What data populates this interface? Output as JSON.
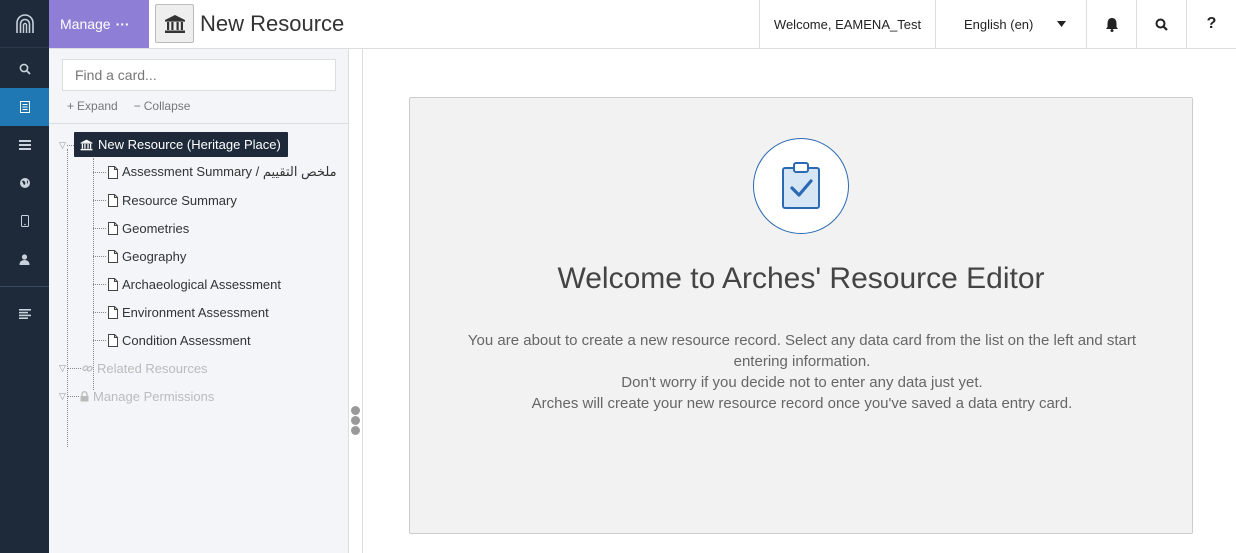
{
  "topbar": {
    "manage_label": "Manage",
    "manage_dots": "···",
    "page_title": "New Resource",
    "welcome": "Welcome, EAMENA_Test",
    "language": "English (en)"
  },
  "sidebar": {
    "search_placeholder": "Find a card...",
    "expand_label": "Expand",
    "collapse_label": "Collapse",
    "root_label": "New Resource (Heritage Place)",
    "cards": [
      "Assessment Summary / ملخص التقييم",
      "Resource Summary",
      "Geometries",
      "Geography",
      "Archaeological Assessment",
      "Environment Assessment",
      "Condition Assessment"
    ],
    "related_label": "Related Resources",
    "permissions_label": "Manage Permissions"
  },
  "main": {
    "title": "Welcome to Arches' Resource Editor",
    "line1": "You are about to create a new resource record. Select any data card from the list on the left and start entering information.",
    "line2": "Don't worry if you decide not to enter any data just yet.",
    "line3": "Arches will create your new resource record once you've saved a data entry card."
  },
  "colors": {
    "rail": "#1e2a3a",
    "rail_active": "#1f78b4",
    "manage": "#8e7ed6",
    "accent": "#2b6ab3"
  },
  "icons": {
    "rail": [
      "arches-logo-icon",
      "search-icon",
      "resource-editor-icon",
      "list-icon",
      "globe-icon",
      "mobile-icon",
      "user-icon",
      "align-icon"
    ],
    "topbar": [
      "museum-icon",
      "bell-icon",
      "search-icon",
      "help-icon"
    ]
  }
}
